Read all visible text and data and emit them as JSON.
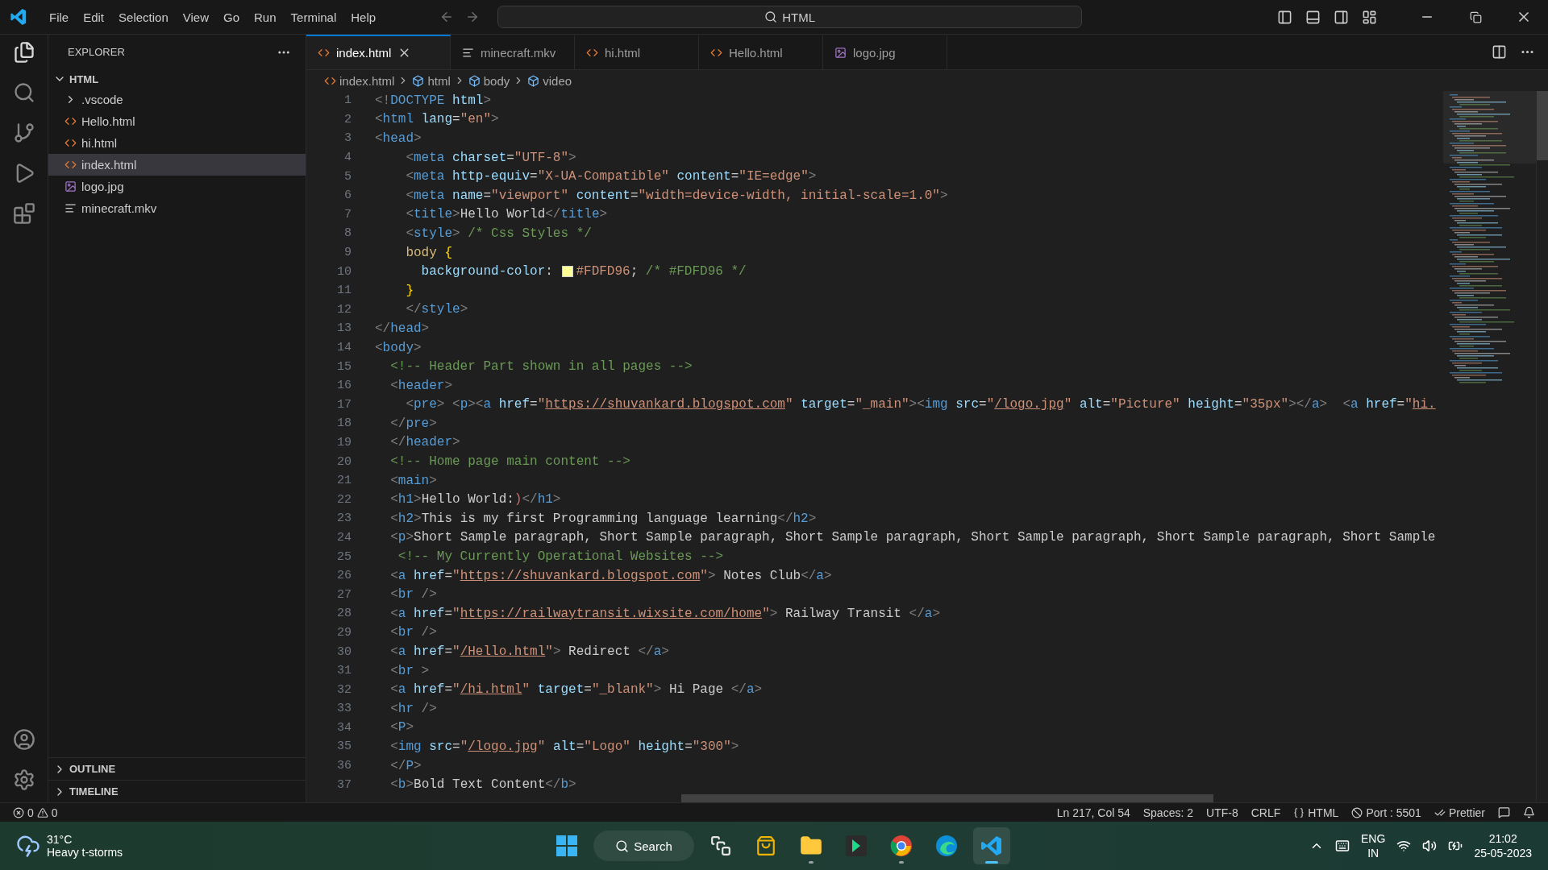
{
  "menu": [
    "File",
    "Edit",
    "Selection",
    "View",
    "Go",
    "Run",
    "Terminal",
    "Help"
  ],
  "command_center": {
    "text": "HTML"
  },
  "explorer": {
    "title": "EXPLORER",
    "folder": {
      "label": "HTML",
      "expanded": true
    },
    "items": [
      {
        "label": ".vscode",
        "kind": "folder",
        "selected": false
      },
      {
        "label": "Hello.html",
        "kind": "html",
        "selected": false
      },
      {
        "label": "hi.html",
        "kind": "html",
        "selected": false
      },
      {
        "label": "index.html",
        "kind": "html",
        "selected": true
      },
      {
        "label": "logo.jpg",
        "kind": "image",
        "selected": false
      },
      {
        "label": "minecraft.mkv",
        "kind": "text",
        "selected": false
      }
    ],
    "sections": [
      {
        "label": "OUTLINE",
        "expanded": false
      },
      {
        "label": "TIMELINE",
        "expanded": false
      }
    ]
  },
  "tabs": [
    {
      "label": "index.html",
      "kind": "html",
      "selected": true
    },
    {
      "label": "minecraft.mkv",
      "kind": "text",
      "selected": false
    },
    {
      "label": "hi.html",
      "kind": "html",
      "selected": false
    },
    {
      "label": "Hello.html",
      "kind": "html",
      "selected": false
    },
    {
      "label": "logo.jpg",
      "kind": "image",
      "selected": false
    }
  ],
  "breadcrumbs": [
    {
      "label": "index.html",
      "kind": "file"
    },
    {
      "label": "html",
      "kind": "element"
    },
    {
      "label": "body",
      "kind": "element"
    },
    {
      "label": "video",
      "kind": "element"
    }
  ],
  "code": {
    "lines": [
      {
        "number": "1",
        "tokens": [
          {
            "kind": "punct",
            "text": "<!"
          },
          {
            "kind": "tag",
            "text": "DOCTYPE"
          },
          {
            "kind": "attr",
            "text": " html"
          },
          {
            "kind": "punct",
            "text": ">"
          }
        ]
      },
      {
        "number": "2",
        "tokens": [
          {
            "kind": "punct",
            "text": "<"
          },
          {
            "kind": "tag",
            "text": "html"
          },
          {
            "kind": "attr",
            "text": " lang"
          },
          {
            "kind": "text",
            "text": "="
          },
          {
            "kind": "string",
            "text": "\"en\""
          },
          {
            "kind": "punct",
            "text": ">"
          }
        ]
      },
      {
        "number": "3",
        "tokens": [
          {
            "kind": "punct",
            "text": "<"
          },
          {
            "kind": "tag",
            "text": "head"
          },
          {
            "kind": "punct",
            "text": ">"
          }
        ]
      },
      {
        "number": "4",
        "tokens": [
          {
            "kind": "punct",
            "text": "    <"
          },
          {
            "kind": "tag",
            "text": "meta"
          },
          {
            "kind": "attr",
            "text": " charset"
          },
          {
            "kind": "text",
            "text": "="
          },
          {
            "kind": "string",
            "text": "\"UTF-8\""
          },
          {
            "kind": "punct",
            "text": ">"
          }
        ]
      },
      {
        "number": "5",
        "tokens": [
          {
            "kind": "punct",
            "text": "    <"
          },
          {
            "kind": "tag",
            "text": "meta"
          },
          {
            "kind": "attr",
            "text": " http-equiv"
          },
          {
            "kind": "text",
            "text": "="
          },
          {
            "kind": "string",
            "text": "\"X-UA-Compatible\""
          },
          {
            "kind": "attr",
            "text": " content"
          },
          {
            "kind": "text",
            "text": "="
          },
          {
            "kind": "string",
            "text": "\"IE=edge\""
          },
          {
            "kind": "punct",
            "text": ">"
          }
        ]
      },
      {
        "number": "6",
        "tokens": [
          {
            "kind": "punct",
            "text": "    <"
          },
          {
            "kind": "tag",
            "text": "meta"
          },
          {
            "kind": "attr",
            "text": " name"
          },
          {
            "kind": "text",
            "text": "="
          },
          {
            "kind": "string",
            "text": "\"viewport\""
          },
          {
            "kind": "attr",
            "text": " content"
          },
          {
            "kind": "text",
            "text": "="
          },
          {
            "kind": "string",
            "text": "\"width=device-width, initial-scale=1.0\""
          },
          {
            "kind": "punct",
            "text": ">"
          }
        ]
      },
      {
        "number": "7",
        "tokens": [
          {
            "kind": "punct",
            "text": "    <"
          },
          {
            "kind": "tag",
            "text": "title"
          },
          {
            "kind": "punct",
            "text": ">"
          },
          {
            "kind": "text",
            "text": "Hello World"
          },
          {
            "kind": "punct",
            "text": "</"
          },
          {
            "kind": "tag",
            "text": "title"
          },
          {
            "kind": "punct",
            "text": ">"
          }
        ]
      },
      {
        "number": "8",
        "tokens": [
          {
            "kind": "punct",
            "text": "    <"
          },
          {
            "kind": "tag",
            "text": "style"
          },
          {
            "kind": "punct",
            "text": ">"
          },
          {
            "kind": "comment",
            "text": " /* Css Styles */"
          }
        ]
      },
      {
        "number": "9",
        "tokens": [
          {
            "kind": "selector",
            "text": "    body"
          },
          {
            "kind": "brace",
            "text": " {"
          }
        ]
      },
      {
        "number": "10",
        "tokens": [
          {
            "kind": "attr",
            "text": "      background-color"
          },
          {
            "kind": "text",
            "text": ": "
          },
          {
            "kind": "string",
            "text": "#FDFD96",
            "color": "#fdfd96"
          },
          {
            "kind": "text",
            "text": "; "
          },
          {
            "kind": "comment",
            "text": "/* #FDFD96 */"
          }
        ]
      },
      {
        "number": "11",
        "tokens": [
          {
            "kind": "brace",
            "text": "    }"
          }
        ]
      },
      {
        "number": "12",
        "tokens": [
          {
            "kind": "punct",
            "text": "    </"
          },
          {
            "kind": "tag",
            "text": "style"
          },
          {
            "kind": "punct",
            "text": ">"
          }
        ]
      },
      {
        "number": "13",
        "tokens": [
          {
            "kind": "punct",
            "text": "</"
          },
          {
            "kind": "tag",
            "text": "head"
          },
          {
            "kind": "punct",
            "text": ">"
          }
        ]
      },
      {
        "number": "14",
        "tokens": [
          {
            "kind": "punct",
            "text": "<"
          },
          {
            "kind": "tag",
            "text": "body"
          },
          {
            "kind": "punct",
            "text": ">"
          }
        ]
      },
      {
        "number": "15",
        "tokens": [
          {
            "kind": "comment",
            "text": "  <!-- Header Part shown in all pages -->"
          }
        ]
      },
      {
        "number": "16",
        "tokens": [
          {
            "kind": "punct",
            "text": "  <"
          },
          {
            "kind": "tag",
            "text": "header"
          },
          {
            "kind": "punct",
            "text": ">"
          }
        ]
      },
      {
        "number": "17",
        "tokens": [
          {
            "kind": "punct",
            "text": "    <"
          },
          {
            "kind": "tag",
            "text": "pre"
          },
          {
            "kind": "punct",
            "text": "> <"
          },
          {
            "kind": "tag",
            "text": "p"
          },
          {
            "kind": "punct",
            "text": "><"
          },
          {
            "kind": "tag",
            "text": "a"
          },
          {
            "kind": "attr",
            "text": " href"
          },
          {
            "kind": "text",
            "text": "="
          },
          {
            "kind": "string",
            "text": "\""
          },
          {
            "kind": "link",
            "text": "https://shuvankard.blogspot.com"
          },
          {
            "kind": "string",
            "text": "\""
          },
          {
            "kind": "attr",
            "text": " target"
          },
          {
            "kind": "text",
            "text": "="
          },
          {
            "kind": "string",
            "text": "\"_main\""
          },
          {
            "kind": "punct",
            "text": "><"
          },
          {
            "kind": "tag",
            "text": "img"
          },
          {
            "kind": "attr",
            "text": " src"
          },
          {
            "kind": "text",
            "text": "="
          },
          {
            "kind": "string",
            "text": "\""
          },
          {
            "kind": "link",
            "text": "/logo.jpg"
          },
          {
            "kind": "string",
            "text": "\""
          },
          {
            "kind": "attr",
            "text": " alt"
          },
          {
            "kind": "text",
            "text": "="
          },
          {
            "kind": "string",
            "text": "\"Picture\""
          },
          {
            "kind": "attr",
            "text": " height"
          },
          {
            "kind": "text",
            "text": "="
          },
          {
            "kind": "string",
            "text": "\"35px\""
          },
          {
            "kind": "punct",
            "text": "></"
          },
          {
            "kind": "tag",
            "text": "a"
          },
          {
            "kind": "punct",
            "text": ">  <"
          },
          {
            "kind": "tag",
            "text": "a"
          },
          {
            "kind": "attr",
            "text": " href"
          },
          {
            "kind": "text",
            "text": "="
          },
          {
            "kind": "string",
            "text": "\""
          },
          {
            "kind": "link",
            "text": "hi."
          }
        ]
      },
      {
        "number": "18",
        "tokens": [
          {
            "kind": "punct",
            "text": "  </"
          },
          {
            "kind": "tag",
            "text": "pre"
          },
          {
            "kind": "punct",
            "text": ">"
          }
        ]
      },
      {
        "number": "19",
        "tokens": [
          {
            "kind": "punct",
            "text": "  </"
          },
          {
            "kind": "tag",
            "text": "header"
          },
          {
            "kind": "punct",
            "text": ">"
          }
        ]
      },
      {
        "number": "20",
        "tokens": [
          {
            "kind": "comment",
            "text": "  <!-- Home page main content -->"
          }
        ]
      },
      {
        "number": "21",
        "tokens": [
          {
            "kind": "punct",
            "text": "  <"
          },
          {
            "kind": "tag",
            "text": "main"
          },
          {
            "kind": "punct",
            "text": ">"
          }
        ]
      },
      {
        "number": "22",
        "tokens": [
          {
            "kind": "punct",
            "text": "  <"
          },
          {
            "kind": "tag",
            "text": "h1"
          },
          {
            "kind": "punct",
            "text": ">"
          },
          {
            "kind": "text",
            "text": "Hello World:"
          },
          {
            "kind": "error",
            "text": ")"
          },
          {
            "kind": "punct",
            "text": "</"
          },
          {
            "kind": "tag",
            "text": "h1"
          },
          {
            "kind": "punct",
            "text": ">"
          }
        ]
      },
      {
        "number": "23",
        "tokens": [
          {
            "kind": "punct",
            "text": "  <"
          },
          {
            "kind": "tag",
            "text": "h2"
          },
          {
            "kind": "punct",
            "text": ">"
          },
          {
            "kind": "text",
            "text": "This is my first Programming language learning"
          },
          {
            "kind": "punct",
            "text": "</"
          },
          {
            "kind": "tag",
            "text": "h2"
          },
          {
            "kind": "punct",
            "text": ">"
          }
        ]
      },
      {
        "number": "24",
        "tokens": [
          {
            "kind": "punct",
            "text": "  <"
          },
          {
            "kind": "tag",
            "text": "p"
          },
          {
            "kind": "punct",
            "text": ">"
          },
          {
            "kind": "text",
            "text": "Short Sample paragraph, Short Sample paragraph, Short Sample paragraph, Short Sample paragraph, Short Sample paragraph, Short Sample"
          }
        ]
      },
      {
        "number": "25",
        "tokens": [
          {
            "kind": "comment",
            "text": "   <!-- My Currently Operational Websites -->"
          }
        ]
      },
      {
        "number": "26",
        "tokens": [
          {
            "kind": "punct",
            "text": "  <"
          },
          {
            "kind": "tag",
            "text": "a"
          },
          {
            "kind": "attr",
            "text": " href"
          },
          {
            "kind": "text",
            "text": "="
          },
          {
            "kind": "string",
            "text": "\""
          },
          {
            "kind": "link",
            "text": "https://shuvankard.blogspot.com"
          },
          {
            "kind": "string",
            "text": "\""
          },
          {
            "kind": "punct",
            "text": ">"
          },
          {
            "kind": "text",
            "text": " Notes Club"
          },
          {
            "kind": "punct",
            "text": "</"
          },
          {
            "kind": "tag",
            "text": "a"
          },
          {
            "kind": "punct",
            "text": ">"
          }
        ]
      },
      {
        "number": "27",
        "tokens": [
          {
            "kind": "punct",
            "text": "  <"
          },
          {
            "kind": "tag",
            "text": "br"
          },
          {
            "kind": "punct",
            "text": " />"
          }
        ]
      },
      {
        "number": "28",
        "tokens": [
          {
            "kind": "punct",
            "text": "  <"
          },
          {
            "kind": "tag",
            "text": "a"
          },
          {
            "kind": "attr",
            "text": " href"
          },
          {
            "kind": "text",
            "text": "="
          },
          {
            "kind": "string",
            "text": "\""
          },
          {
            "kind": "link",
            "text": "https://railwaytransit.wixsite.com/home"
          },
          {
            "kind": "string",
            "text": "\""
          },
          {
            "kind": "punct",
            "text": ">"
          },
          {
            "kind": "text",
            "text": " Railway Transit "
          },
          {
            "kind": "punct",
            "text": "</"
          },
          {
            "kind": "tag",
            "text": "a"
          },
          {
            "kind": "punct",
            "text": ">"
          }
        ]
      },
      {
        "number": "29",
        "tokens": [
          {
            "kind": "punct",
            "text": "  <"
          },
          {
            "kind": "tag",
            "text": "br"
          },
          {
            "kind": "punct",
            "text": " />"
          }
        ]
      },
      {
        "number": "30",
        "tokens": [
          {
            "kind": "punct",
            "text": "  <"
          },
          {
            "kind": "tag",
            "text": "a"
          },
          {
            "kind": "attr",
            "text": " href"
          },
          {
            "kind": "text",
            "text": "="
          },
          {
            "kind": "string",
            "text": "\""
          },
          {
            "kind": "link",
            "text": "/Hello.html"
          },
          {
            "kind": "string",
            "text": "\""
          },
          {
            "kind": "punct",
            "text": ">"
          },
          {
            "kind": "text",
            "text": " Redirect "
          },
          {
            "kind": "punct",
            "text": "</"
          },
          {
            "kind": "tag",
            "text": "a"
          },
          {
            "kind": "punct",
            "text": ">"
          }
        ]
      },
      {
        "number": "31",
        "tokens": [
          {
            "kind": "punct",
            "text": "  <"
          },
          {
            "kind": "tag",
            "text": "br"
          },
          {
            "kind": "punct",
            "text": " >"
          }
        ]
      },
      {
        "number": "32",
        "tokens": [
          {
            "kind": "punct",
            "text": "  <"
          },
          {
            "kind": "tag",
            "text": "a"
          },
          {
            "kind": "attr",
            "text": " href"
          },
          {
            "kind": "text",
            "text": "="
          },
          {
            "kind": "string",
            "text": "\""
          },
          {
            "kind": "link",
            "text": "/hi.html"
          },
          {
            "kind": "string",
            "text": "\""
          },
          {
            "kind": "attr",
            "text": " target"
          },
          {
            "kind": "text",
            "text": "="
          },
          {
            "kind": "string",
            "text": "\"_blank\""
          },
          {
            "kind": "punct",
            "text": ">"
          },
          {
            "kind": "text",
            "text": " Hi Page "
          },
          {
            "kind": "punct",
            "text": "</"
          },
          {
            "kind": "tag",
            "text": "a"
          },
          {
            "kind": "punct",
            "text": ">"
          }
        ]
      },
      {
        "number": "33",
        "tokens": [
          {
            "kind": "punct",
            "text": "  <"
          },
          {
            "kind": "tag",
            "text": "hr"
          },
          {
            "kind": "punct",
            "text": " />"
          }
        ]
      },
      {
        "number": "34",
        "tokens": [
          {
            "kind": "punct",
            "text": "  <"
          },
          {
            "kind": "tag",
            "text": "P"
          },
          {
            "kind": "punct",
            "text": ">"
          }
        ]
      },
      {
        "number": "35",
        "tokens": [
          {
            "kind": "punct",
            "text": "  <"
          },
          {
            "kind": "tag",
            "text": "img"
          },
          {
            "kind": "attr",
            "text": " src"
          },
          {
            "kind": "text",
            "text": "="
          },
          {
            "kind": "string",
            "text": "\""
          },
          {
            "kind": "link",
            "text": "/logo.jpg"
          },
          {
            "kind": "string",
            "text": "\""
          },
          {
            "kind": "attr",
            "text": " alt"
          },
          {
            "kind": "text",
            "text": "="
          },
          {
            "kind": "string",
            "text": "\"Logo\""
          },
          {
            "kind": "attr",
            "text": " height"
          },
          {
            "kind": "text",
            "text": "="
          },
          {
            "kind": "string",
            "text": "\"300\""
          },
          {
            "kind": "punct",
            "text": ">"
          }
        ]
      },
      {
        "number": "36",
        "tokens": [
          {
            "kind": "punct",
            "text": "  </"
          },
          {
            "kind": "tag",
            "text": "P"
          },
          {
            "kind": "punct",
            "text": ">"
          }
        ]
      },
      {
        "number": "37",
        "tokens": [
          {
            "kind": "punct",
            "text": "  <"
          },
          {
            "kind": "tag",
            "text": "b"
          },
          {
            "kind": "punct",
            "text": ">"
          },
          {
            "kind": "text",
            "text": "Bold Text Content"
          },
          {
            "kind": "punct",
            "text": "</"
          },
          {
            "kind": "tag",
            "text": "b"
          },
          {
            "kind": "punct",
            "text": ">"
          }
        ]
      }
    ]
  },
  "status_bar": {
    "errors": "0",
    "warnings": "0",
    "items": [
      {
        "text": "Ln 217, Col 54",
        "kind": "plain"
      },
      {
        "text": "Spaces: 2",
        "kind": "plain"
      },
      {
        "text": "UTF-8",
        "kind": "plain"
      },
      {
        "text": "CRLF",
        "kind": "plain"
      },
      {
        "text": "HTML",
        "kind": "language"
      },
      {
        "text": "Port : 5501",
        "kind": "port"
      },
      {
        "text": "Prettier",
        "kind": "formatter"
      }
    ]
  },
  "taskbar": {
    "weather": {
      "temperature": "31°C",
      "condition": "Heavy t-storms"
    },
    "search": "Search",
    "apps": [
      {
        "kind": "taskview",
        "running": false,
        "selected": false
      },
      {
        "kind": "store",
        "running": false,
        "selected": false
      },
      {
        "kind": "files",
        "running": true,
        "selected": false
      },
      {
        "kind": "editor",
        "running": false,
        "selected": false
      },
      {
        "kind": "chrome",
        "running": true,
        "selected": false
      },
      {
        "kind": "edge",
        "running": false,
        "selected": false
      },
      {
        "kind": "vscode",
        "running": true,
        "selected": true
      }
    ],
    "tray": {
      "language": "ENG",
      "region": "IN",
      "time": "21:02",
      "date": "25-05-2023"
    }
  }
}
